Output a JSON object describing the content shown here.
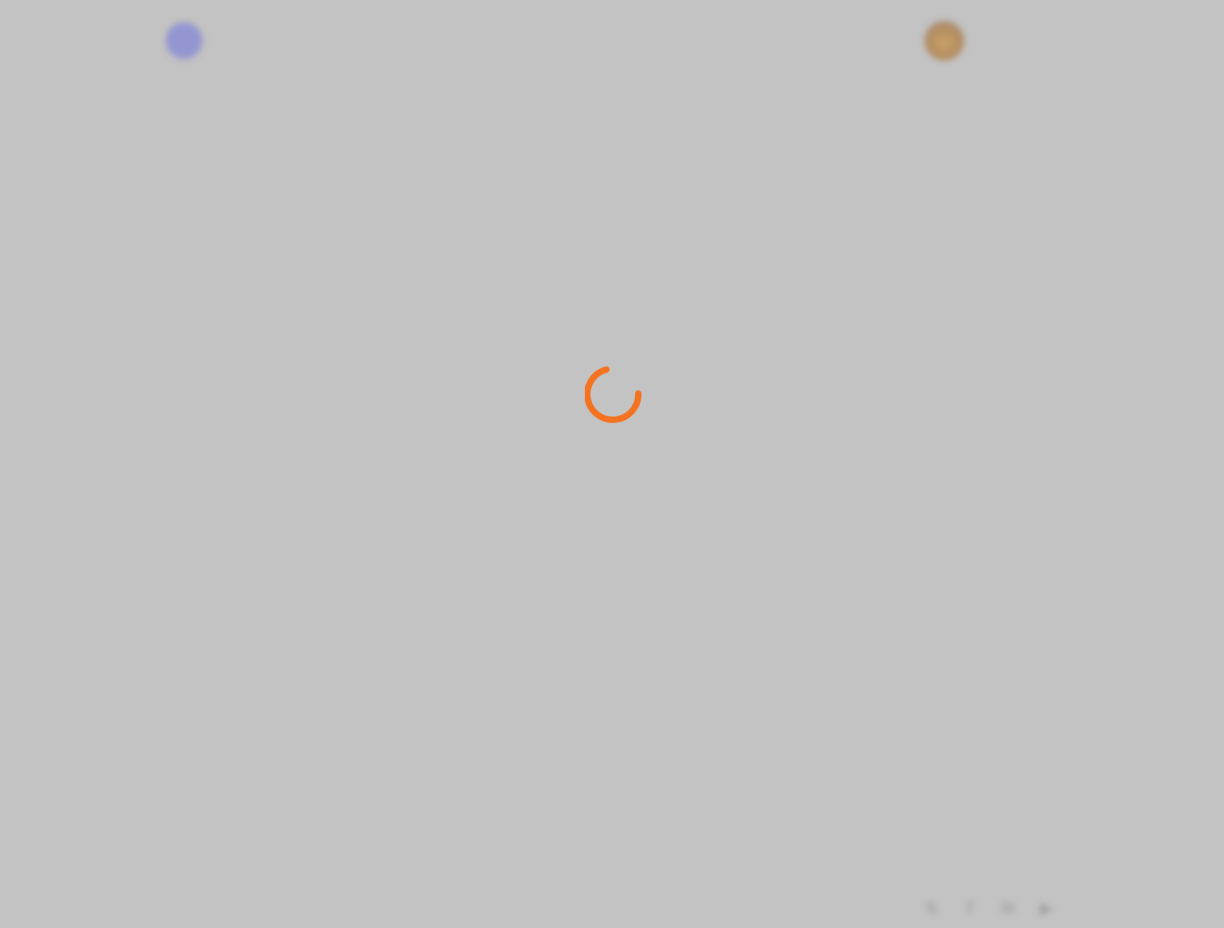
{
  "app": {
    "logo_initial": "",
    "logo_text": "",
    "page_title": "",
    "user_name": ""
  },
  "footer": {
    "copyright": "",
    "social_icons": [
      "twitter-icon",
      "facebook-icon",
      "linkedin-icon",
      "youtube-icon"
    ]
  },
  "loading": {
    "spinner_color": "#f47322",
    "logo_color": "#7b7ed9",
    "background_color": "#c3c3c3"
  }
}
